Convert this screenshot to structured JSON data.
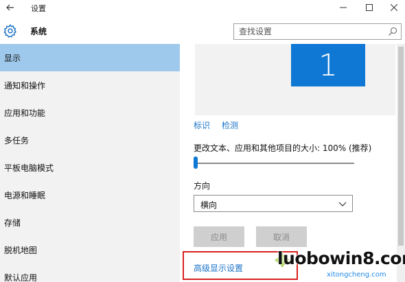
{
  "window": {
    "title": "设置"
  },
  "header": {
    "app_name": "系统",
    "search_placeholder": "查找设置"
  },
  "sidebar": {
    "items": [
      {
        "label": "显示",
        "active": true
      },
      {
        "label": "通知和操作",
        "active": false
      },
      {
        "label": "应用和功能",
        "active": false
      },
      {
        "label": "多任务",
        "active": false
      },
      {
        "label": "平板电脑模式",
        "active": false
      },
      {
        "label": "电源和睡眠",
        "active": false
      },
      {
        "label": "存储",
        "active": false
      },
      {
        "label": "脱机地图",
        "active": false
      },
      {
        "label": "默认应用",
        "active": false
      }
    ]
  },
  "display": {
    "monitor_number": "1",
    "identify_link": "标识",
    "detect_link": "检测",
    "scale_label": "更改文本、应用和其他项目的大小: 100% (推荐)",
    "scale_level_fraction": 0.0,
    "orientation_label": "方向",
    "orientation_value": "横向",
    "apply_button": "应用",
    "cancel_button": "取消",
    "advanced_link": "高级显示设置"
  },
  "watermark": {
    "main": "luobowin8.com",
    "sub": "xitongcheng.com"
  },
  "colors": {
    "accent": "#0f77d4",
    "active_item": "#9fc9ec",
    "link": "#1a73c7",
    "highlight_box": "#d81e1e"
  }
}
